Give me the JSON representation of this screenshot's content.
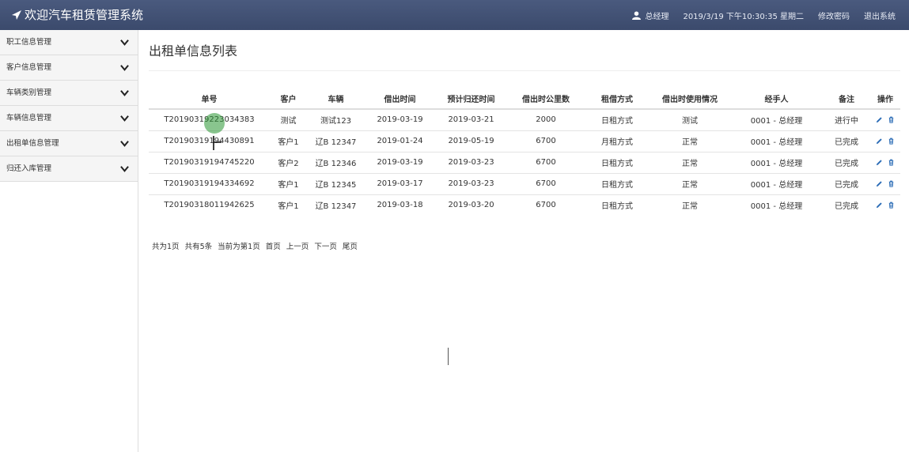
{
  "navbar": {
    "brand": "欢迎汽车租赁管理系统",
    "user": "总经理",
    "datetime": "2019/3/19 下午10:30:35 星期二",
    "change_password": "修改密码",
    "logout": "退出系统"
  },
  "sidebar": {
    "items": [
      {
        "label": "职工信息管理"
      },
      {
        "label": "客户信息管理"
      },
      {
        "label": "车辆类别管理"
      },
      {
        "label": "车辆信息管理"
      },
      {
        "label": "出租单信息管理"
      },
      {
        "label": "归还入库管理"
      }
    ]
  },
  "main": {
    "title": "出租单信息列表",
    "headers": [
      "单号",
      "客户",
      "车辆",
      "借出时间",
      "预计归还时间",
      "借出时公里数",
      "租借方式",
      "借出时使用情况",
      "经手人",
      "备注",
      "操作"
    ],
    "rows": [
      [
        "T20190319223034383",
        "测试",
        "测试123",
        "2019-03-19",
        "2019-03-21",
        "2000",
        "日租方式",
        "测试",
        "0001 - 总经理",
        "进行中"
      ],
      [
        "T20190319194430891",
        "客户1",
        "辽B 12347",
        "2019-01-24",
        "2019-05-19",
        "6700",
        "月租方式",
        "正常",
        "0001 - 总经理",
        "已完成"
      ],
      [
        "T20190319194745220",
        "客户2",
        "辽B 12346",
        "2019-03-19",
        "2019-03-23",
        "6700",
        "日租方式",
        "正常",
        "0001 - 总经理",
        "已完成"
      ],
      [
        "T20190319194334692",
        "客户1",
        "辽B 12345",
        "2019-03-17",
        "2019-03-23",
        "6700",
        "日租方式",
        "正常",
        "0001 - 总经理",
        "已完成"
      ],
      [
        "T20190318011942625",
        "客户1",
        "辽B 12347",
        "2019-03-18",
        "2019-03-20",
        "6700",
        "日租方式",
        "正常",
        "0001 - 总经理",
        "已完成"
      ]
    ]
  },
  "pager": {
    "total_pages": "共为1页",
    "total_records": "共有5条",
    "current": "当前为第1页",
    "first": "首页",
    "prev": "上一页",
    "next": "下一页",
    "last": "尾页"
  },
  "colors": {
    "navbar": "#3b4a6c",
    "action_icon": "#2b6cb6",
    "cursor": "#28963280"
  },
  "icons": {
    "brand": "send-arrow-icon",
    "user": "user-icon",
    "chevron": "chevron-down-icon",
    "edit": "pencil-icon",
    "delete": "trash-icon"
  }
}
